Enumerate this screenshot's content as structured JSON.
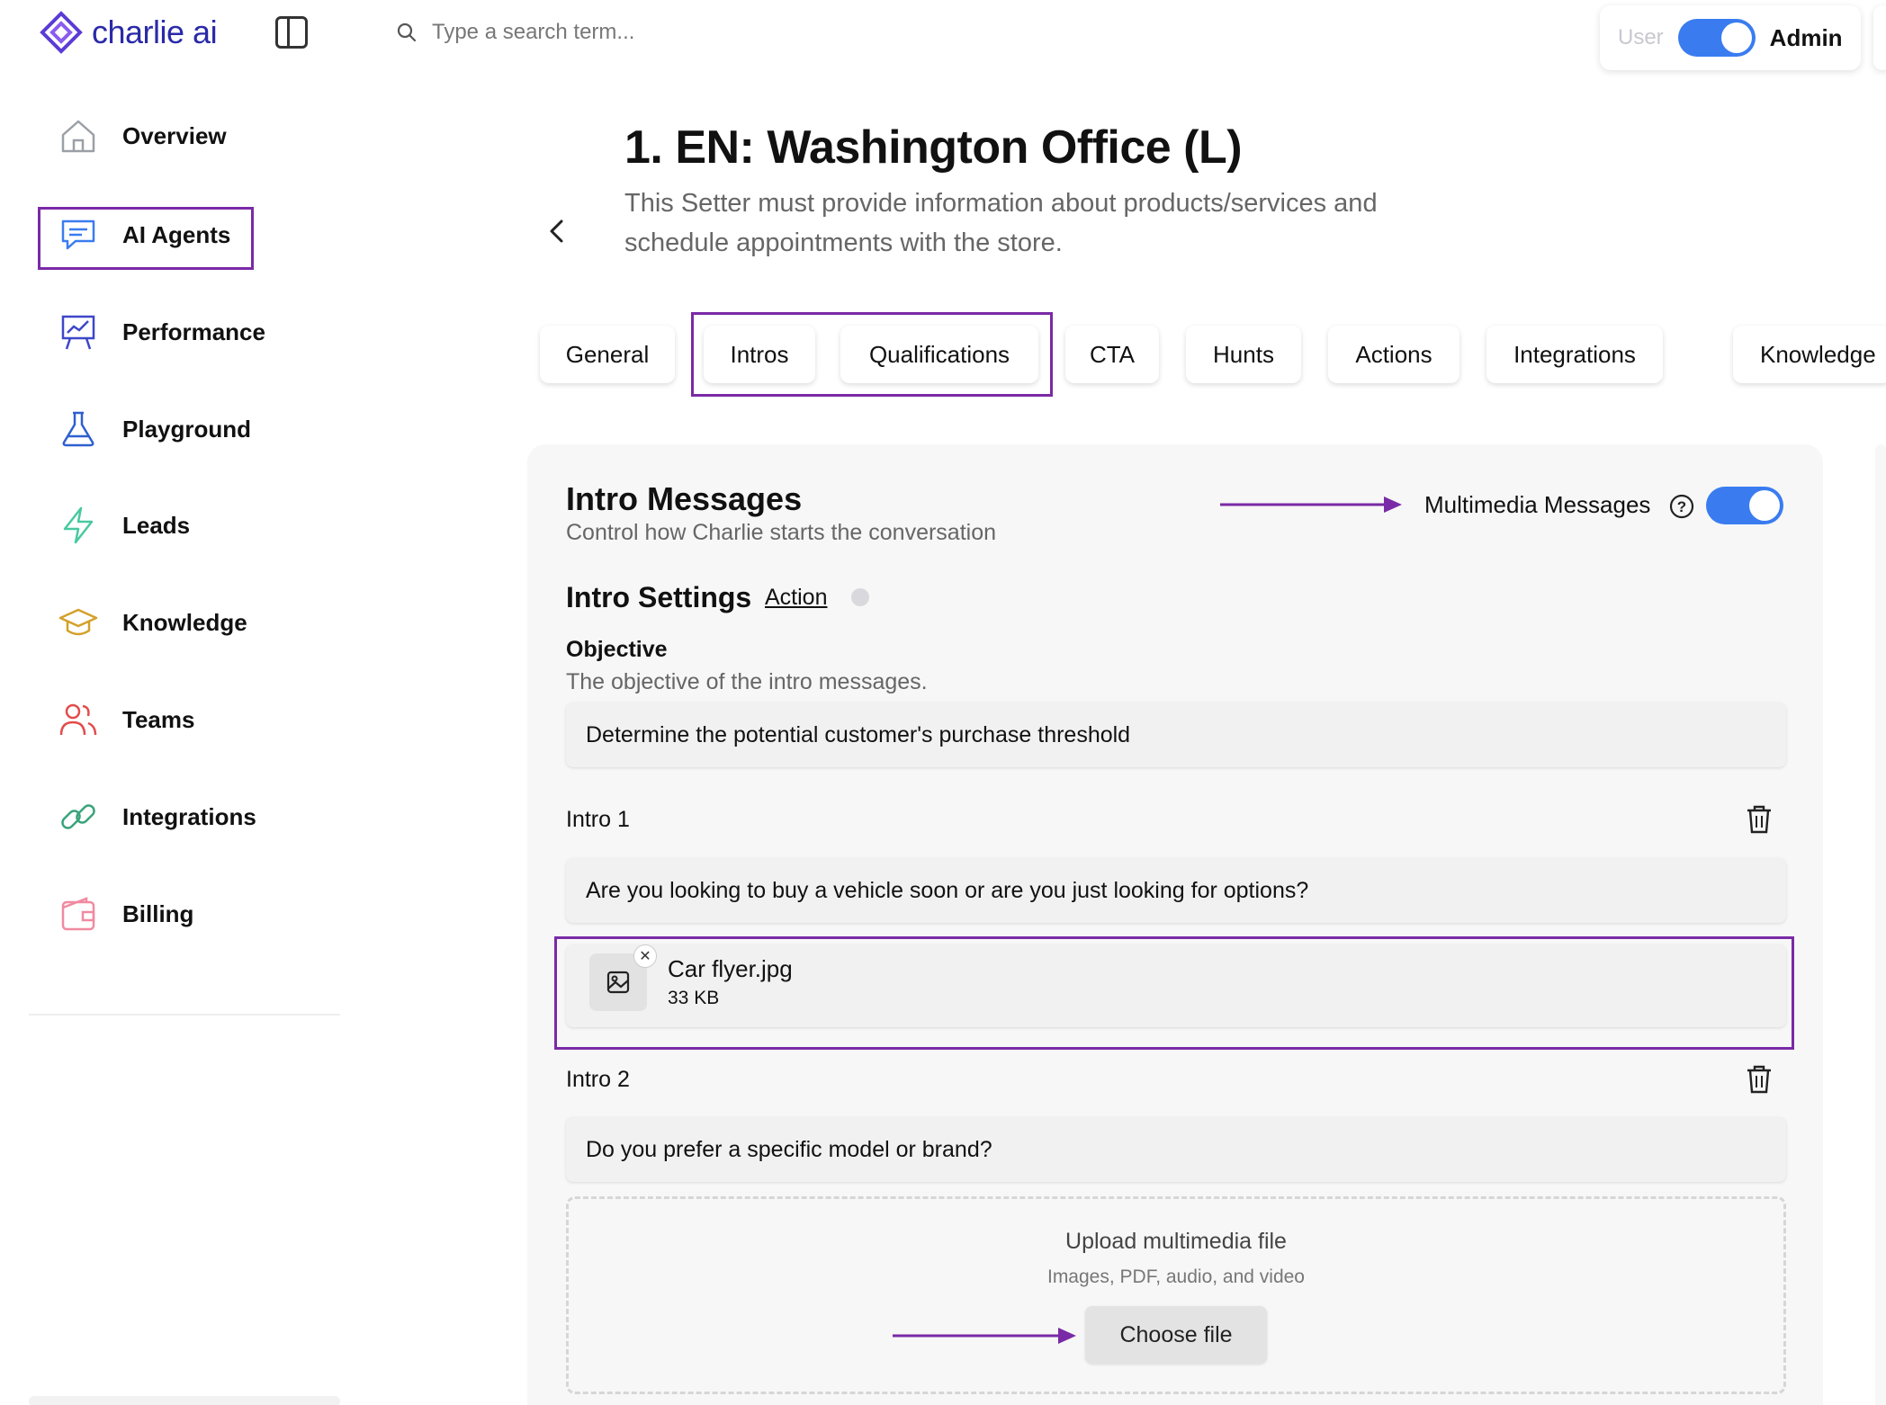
{
  "app": {
    "logo_text": "charlie ai"
  },
  "search": {
    "placeholder": "Type a search term..."
  },
  "role": {
    "user_label": "User",
    "admin_label": "Admin"
  },
  "sidebar": {
    "items": [
      {
        "label": "Overview",
        "icon": "home-icon"
      },
      {
        "label": "AI Agents",
        "icon": "chat-icon"
      },
      {
        "label": "Performance",
        "icon": "chart-board-icon"
      },
      {
        "label": "Playground",
        "icon": "flask-icon"
      },
      {
        "label": "Leads",
        "icon": "lightning-icon"
      },
      {
        "label": "Knowledge",
        "icon": "graduation-cap-icon"
      },
      {
        "label": "Teams",
        "icon": "users-icon"
      },
      {
        "label": "Integrations",
        "icon": "link-icon"
      },
      {
        "label": "Billing",
        "icon": "wallet-icon"
      }
    ]
  },
  "header": {
    "title": "1. EN: Washington Office (L)",
    "subtitle": "This Setter must provide information about products/services and schedule appointments with the store."
  },
  "tabs": [
    "General",
    "Intros",
    "Qualifications",
    "CTA",
    "Hunts",
    "Actions",
    "Integrations",
    "Knowledge"
  ],
  "intro_messages": {
    "title": "Intro Messages",
    "subtitle": "Control how Charlie starts the conversation",
    "multimedia_label": "Multimedia Messages",
    "multimedia_enabled": true
  },
  "intro_settings": {
    "title": "Intro Settings",
    "action_link": "Action",
    "objective_label": "Objective",
    "objective_help": "The objective of the intro messages.",
    "objective_value": "Determine the potential customer's purchase threshold"
  },
  "intros": [
    {
      "label": "Intro 1",
      "message": "Are you looking to buy a vehicle soon or are you just looking for options?",
      "attachment": {
        "name": "Car flyer.jpg",
        "size": "33 KB"
      }
    },
    {
      "label": "Intro 2",
      "message": "Do you prefer a specific model or brand?"
    }
  ],
  "upload": {
    "title": "Upload multimedia file",
    "subtitle": "Images, PDF, audio, and video",
    "button": "Choose file"
  },
  "colors": {
    "accent": "#3a7cf0",
    "highlight": "#7a2aa6",
    "logo": "#2a2aa8"
  }
}
